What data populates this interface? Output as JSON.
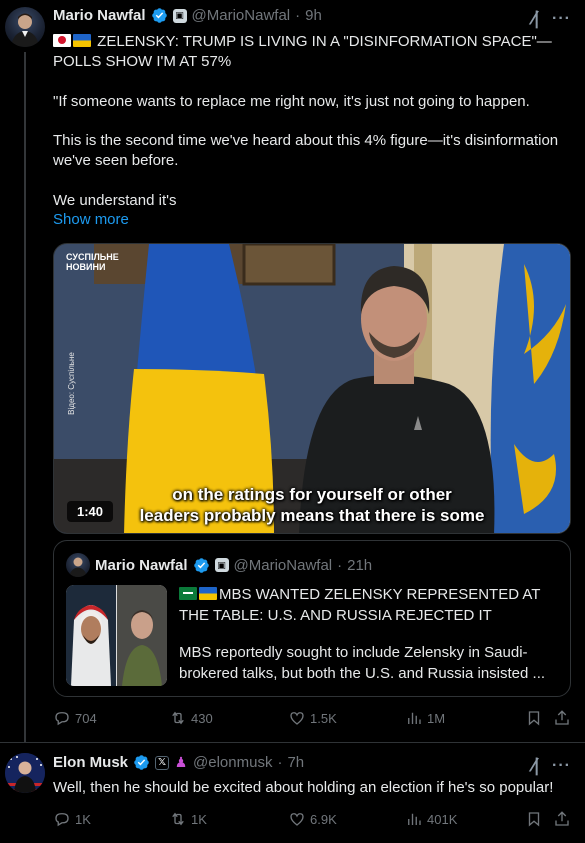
{
  "tweet1": {
    "author_name": "Mario Nawfal",
    "handle": "@MarioNawfal",
    "separator": "·",
    "time": "9h",
    "headline": "ZELENSKY: TRUMP IS LIVING IN A \"DISINFORMATION SPACE\"—POLLS SHOW I'M AT 57%",
    "paragraph1": "\"If someone wants to replace me right now, it's just not going to happen.",
    "paragraph2": "This is the second time we've heard about this 4% figure—it's disinformation we've seen before.",
    "paragraph3": "We understand it's",
    "show_more": "Show more",
    "video": {
      "logo_line1": "СУСПІЛЬНЕ",
      "logo_line2": "НОВИНИ",
      "credit": "Відео: Суспільне",
      "duration": "1:40",
      "caption_line1": "on the ratings for yourself or other",
      "caption_line2": "leaders probably means that there is some"
    },
    "quote": {
      "author_name": "Mario Nawfal",
      "handle": "@MarioNawfal",
      "separator": "·",
      "time": "21h",
      "headline": "MBS WANTED ZELENSKY REPRESENTED AT THE TABLE: U.S. AND RUSSIA REJECTED IT",
      "body": "MBS reportedly sought to include Zelensky in Saudi-brokered talks, but both the U.S. and Russia insisted ..."
    },
    "stats": {
      "replies": "704",
      "reposts": "430",
      "likes": "1.5K",
      "views": "1M"
    }
  },
  "tweet2": {
    "author_name": "Elon Musk",
    "handle": "@elonmusk",
    "separator": "·",
    "time": "7h",
    "text": "Well, then he should be excited about holding an election if he's so popular!",
    "stats": {
      "replies": "1K",
      "reposts": "1K",
      "likes": "6.9K",
      "views": "401K"
    }
  },
  "icons": {
    "verified": "verified-badge-icon",
    "grok": "grok-icon",
    "more": "more-options-icon",
    "reply": "reply-icon",
    "repost": "repost-icon",
    "like": "like-icon",
    "views": "views-icon",
    "bookmark": "bookmark-icon",
    "share": "share-icon"
  },
  "colors": {
    "background": "#000000",
    "text": "#e7e9ea",
    "muted": "#71767b",
    "link": "#1d9bf0",
    "verified": "#1d9bf0",
    "border": "#2f3336"
  }
}
